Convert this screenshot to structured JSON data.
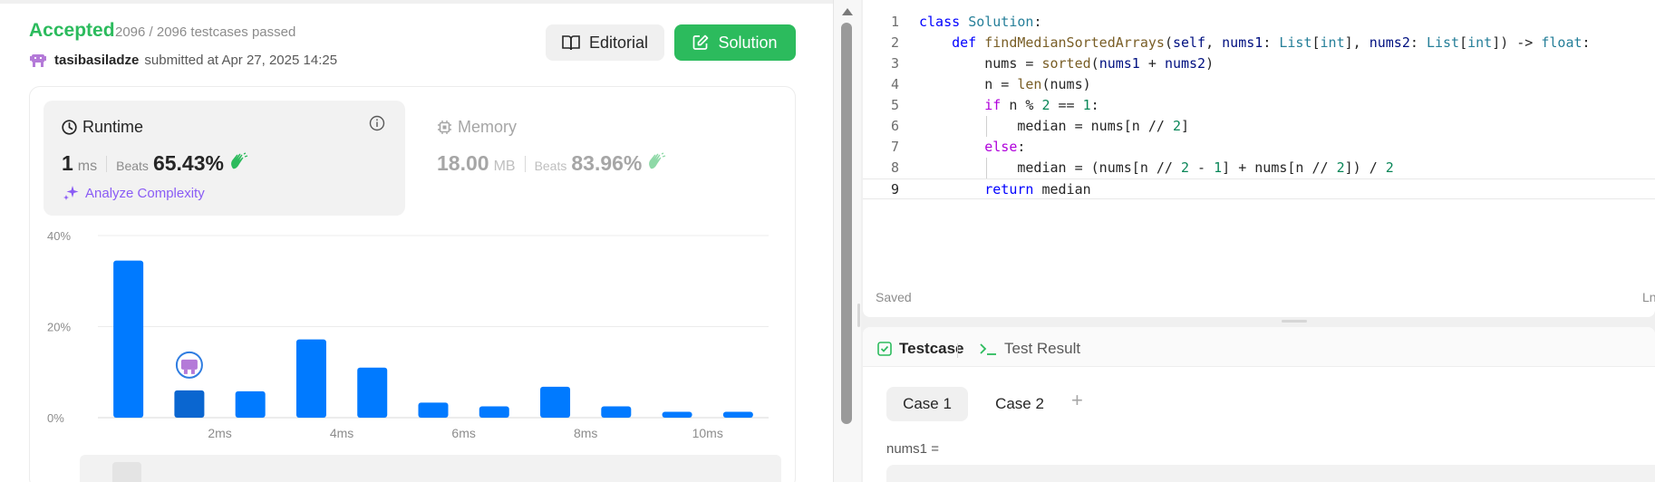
{
  "submission": {
    "status": "Accepted",
    "testcases": "2096 / 2096 testcases passed",
    "username": "tasibasiladze",
    "submitted_at": "submitted at Apr 27, 2025 14:25"
  },
  "buttons": {
    "editorial": "Editorial",
    "solution": "Solution"
  },
  "runtime": {
    "label": "Runtime",
    "value": "1",
    "unit": "ms",
    "beats_label": "Beats",
    "beats_value": "65.43%",
    "analyze": "Analyze Complexity"
  },
  "memory": {
    "label": "Memory",
    "value": "18.00",
    "unit": "MB",
    "beats_label": "Beats",
    "beats_value": "83.96%"
  },
  "chart_data": {
    "type": "bar",
    "x": [
      1,
      2,
      3,
      4,
      5,
      6,
      7,
      8,
      9,
      10,
      11
    ],
    "values": [
      34.5,
      6,
      5.8,
      17.2,
      11,
      3.3,
      2.5,
      6.8,
      2.5,
      1.3,
      1.3
    ],
    "highlight_index": 1,
    "yticks": [
      "0%",
      "20%",
      "40%"
    ],
    "ytick_values": [
      0,
      20,
      40
    ],
    "xticks": [
      "2ms",
      "4ms",
      "6ms",
      "8ms",
      "10ms"
    ],
    "ylim": [
      0,
      40
    ],
    "colors": {
      "bar": "#007aff",
      "highlight": "#0a66d0"
    }
  },
  "editor": {
    "lines": [
      "class Solution:",
      "    def findMedianSortedArrays(self, nums1: List[int], nums2: List[int]) -> float:",
      "        nums = sorted(nums1 + nums2)",
      "        n = len(nums)",
      "        if n % 2 == 1:",
      "            median = nums[n // 2]",
      "        else:",
      "            median = (nums[n // 2 - 1] + nums[n // 2]) / 2",
      "        return median"
    ],
    "saved": "Saved",
    "corner": "Ln"
  },
  "testcase": {
    "tab_testcase": "Testcase",
    "tab_result": "Test Result",
    "cases": [
      "Case 1",
      "Case 2"
    ],
    "add": "+",
    "field_label": "nums1 ="
  },
  "colors": {
    "accent_green": "#2cbb5d",
    "bar_blue": "#007aff",
    "purple": "#8a5cf5"
  }
}
